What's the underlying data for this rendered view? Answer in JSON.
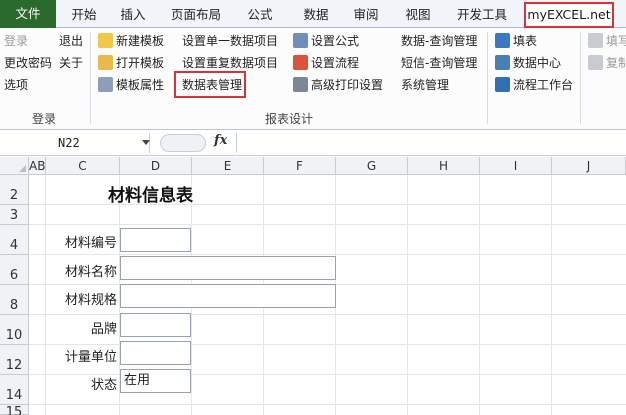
{
  "tabs": [
    "文件",
    "开始",
    "插入",
    "页面布局",
    "公式",
    "数据",
    "审阅",
    "视图",
    "开发工具",
    "myEXCEL.net"
  ],
  "ribbon": {
    "login_group": {
      "items": [
        "登录",
        "退出",
        "更改密码",
        "关于",
        "选项"
      ],
      "label": "登录"
    },
    "design_group": {
      "items": [
        "新建模板",
        "打开模板",
        "模板属性",
        "设置单一数据项目",
        "设置重复数据项目",
        "数据表管理",
        "设置公式",
        "设置流程",
        "高级打印设置",
        "数据-查询管理",
        "短信-查询管理",
        "系统管理"
      ],
      "label": "报表设计"
    },
    "right_group": {
      "items": [
        "填表",
        "数据中心",
        "流程工作台"
      ]
    },
    "clipped_group": {
      "items": [
        "填写",
        "复制"
      ]
    }
  },
  "formula_bar": {
    "name_box": "N22",
    "fx": "fx",
    "content": ""
  },
  "grid": {
    "columns": [
      "AB",
      "C",
      "D",
      "E",
      "F",
      "G",
      "H",
      "I",
      "J"
    ],
    "rows": [
      "2",
      "3",
      "4",
      "6",
      "8",
      "10",
      "12",
      "14",
      "15"
    ]
  },
  "form": {
    "title": "材料信息表",
    "fields": [
      {
        "label": "材料编号",
        "value": ""
      },
      {
        "label": "材料名称",
        "value": ""
      },
      {
        "label": "材料规格",
        "value": ""
      },
      {
        "label": "品牌",
        "value": ""
      },
      {
        "label": "计量单位",
        "value": ""
      },
      {
        "label": "状态",
        "value": "在用"
      }
    ]
  },
  "colors": {
    "file_tab": "#2b6a2d",
    "highlight": "#d8333a",
    "header_bg": "#f0f2f5"
  }
}
